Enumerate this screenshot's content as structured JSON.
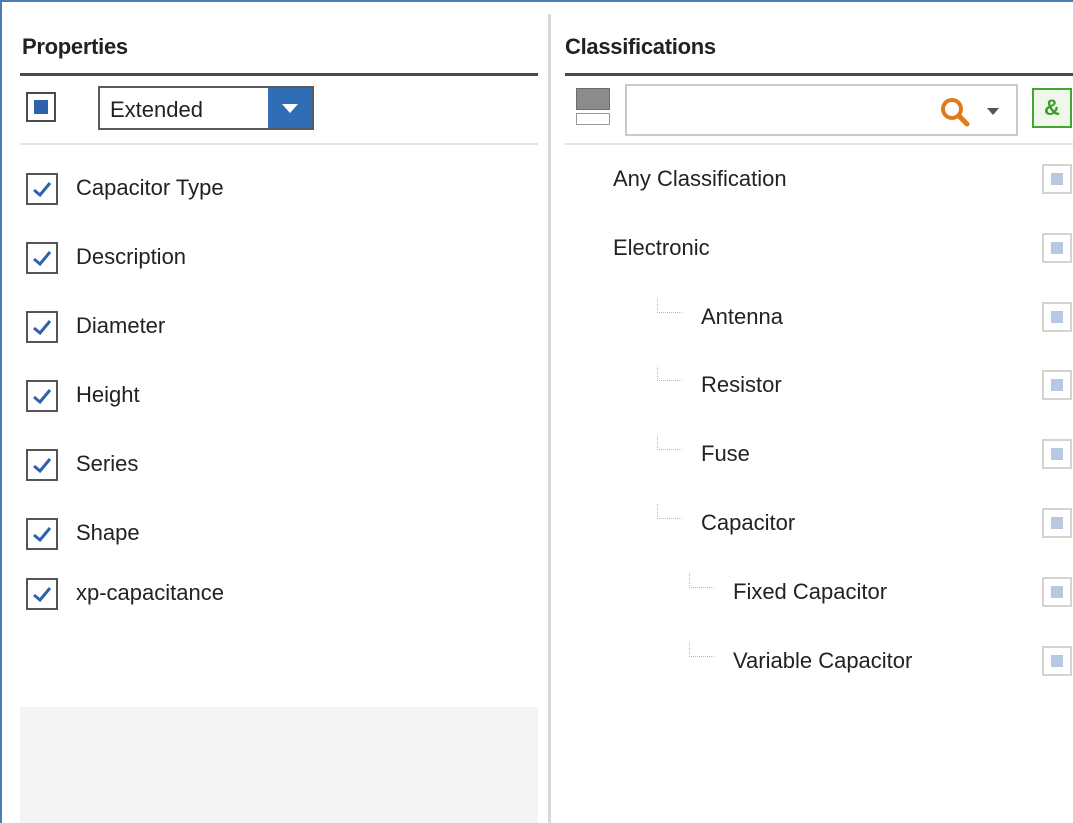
{
  "properties": {
    "title": "Properties",
    "view_select": {
      "value": "Extended"
    },
    "items": [
      {
        "label": "Capacitor Type",
        "checked": true
      },
      {
        "label": "Description",
        "checked": true
      },
      {
        "label": "Diameter",
        "checked": true
      },
      {
        "label": "Height",
        "checked": true
      },
      {
        "label": "Series",
        "checked": true
      },
      {
        "label": "Shape",
        "checked": true
      },
      {
        "label": "xp-capacitance",
        "checked": true
      }
    ]
  },
  "classifications": {
    "title": "Classifications",
    "search": {
      "value": "",
      "placeholder": ""
    },
    "and_button_label": "&",
    "items": [
      {
        "label": "Any Classification",
        "level": 0
      },
      {
        "label": "Electronic",
        "level": 0
      },
      {
        "label": "Antenna",
        "level": 1
      },
      {
        "label": "Resistor",
        "level": 1
      },
      {
        "label": "Fuse",
        "level": 1
      },
      {
        "label": "Capacitor",
        "level": 1
      },
      {
        "label": "Fixed Capacitor",
        "level": 2
      },
      {
        "label": "Variable Capacitor",
        "level": 2
      }
    ]
  },
  "colors": {
    "accent_blue": "#2f6db4",
    "checkbox_tick": "#2e62ad",
    "search_icon_orange": "#e07a1a",
    "and_button_green": "#45a534"
  },
  "icons": {
    "select_all": "select-all-icon",
    "dropdown": "chevron-down-icon",
    "layout": "layout-toggle-icon",
    "search": "search-icon",
    "tree_connector": "tree-connector-icon"
  }
}
